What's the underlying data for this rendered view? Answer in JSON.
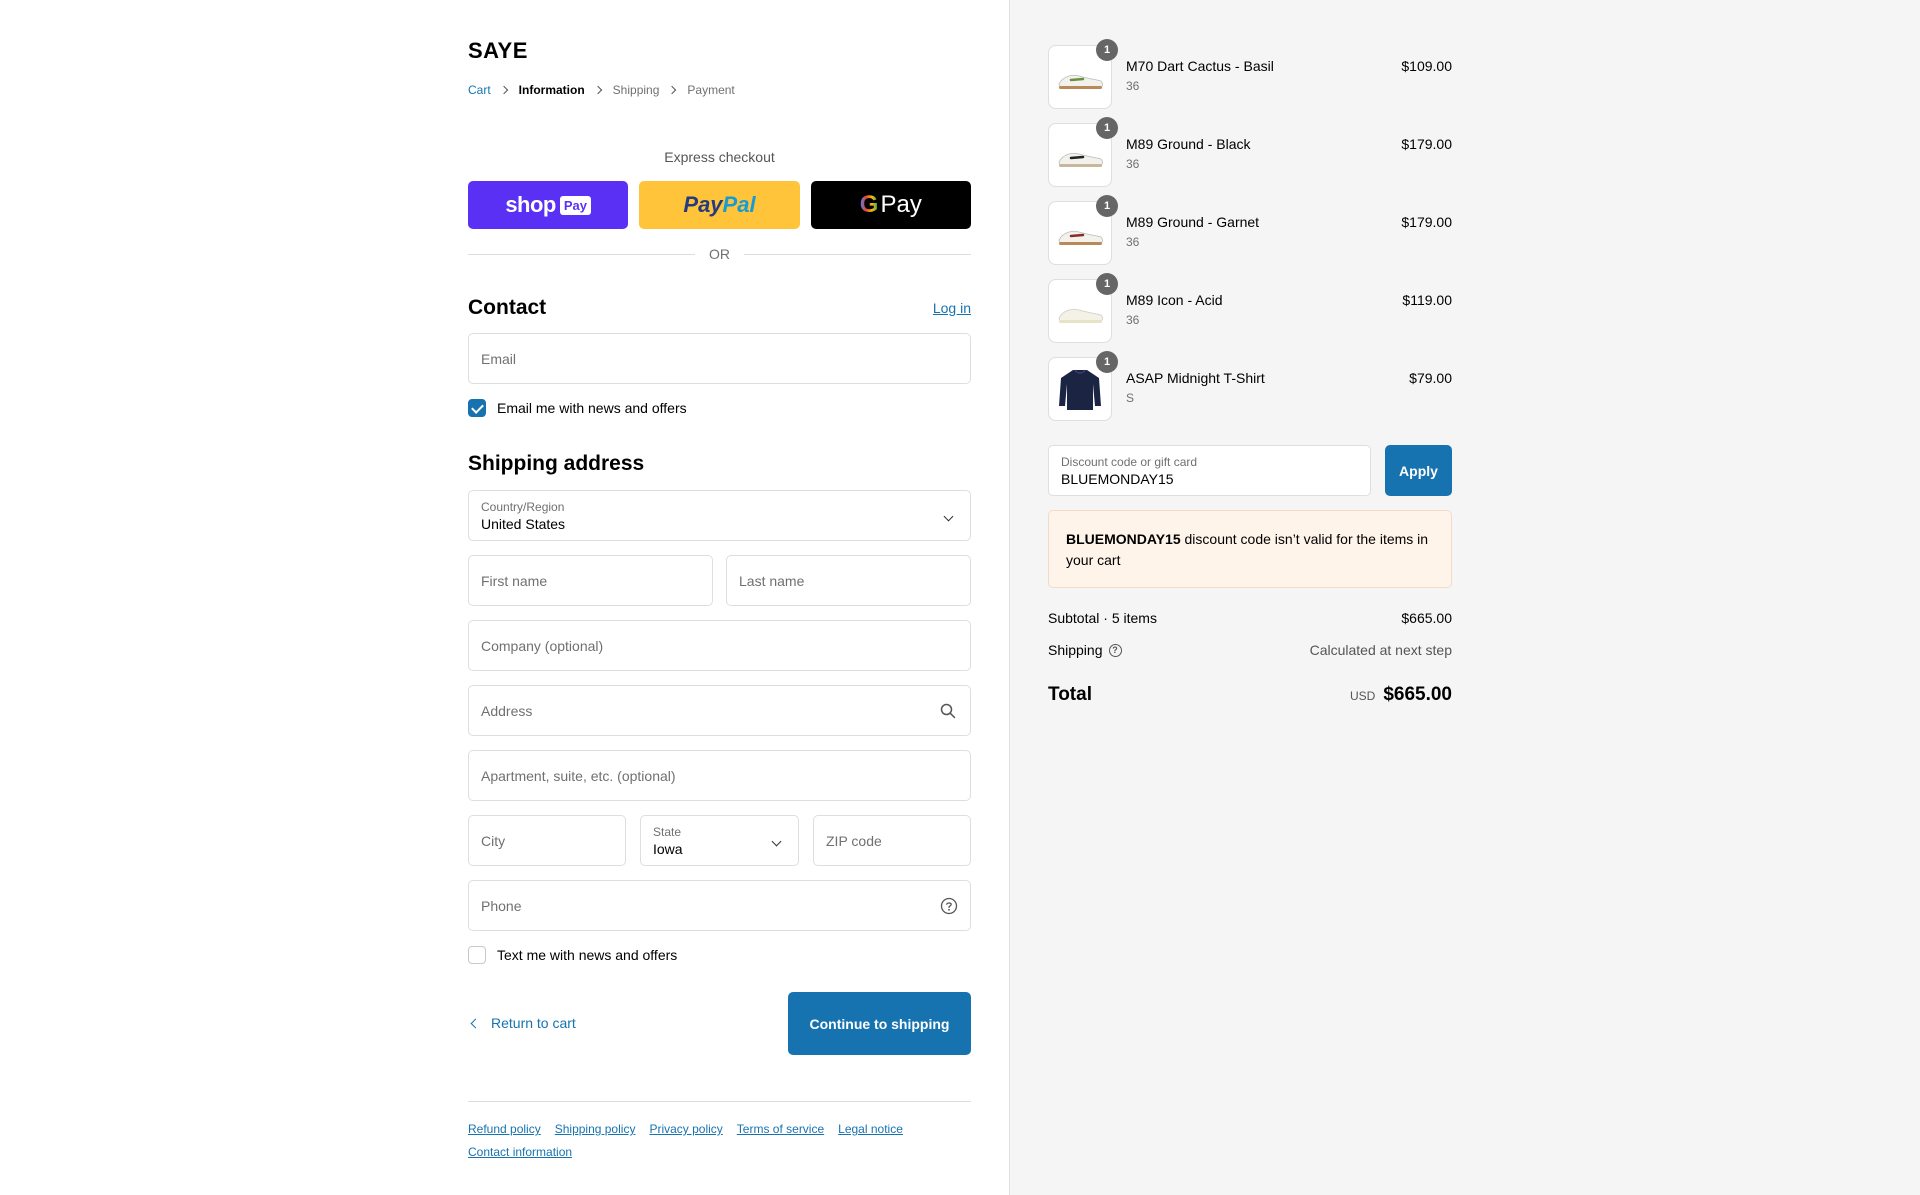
{
  "store": {
    "name": "SAYE"
  },
  "breadcrumb": [
    "Cart",
    "Information",
    "Shipping",
    "Payment"
  ],
  "express": {
    "title": "Express checkout",
    "shop_pay": {
      "shop": "shop",
      "pay": "Pay"
    },
    "paypal": {
      "part1": "Pay",
      "part2": "Pal"
    },
    "gpay": {
      "g": "G",
      "pay": "Pay"
    },
    "or": "OR"
  },
  "contact": {
    "title": "Contact",
    "login": "Log in",
    "email_placeholder": "Email",
    "email_optin": "Email me with news and offers",
    "email_optin_checked": true
  },
  "shipping": {
    "title": "Shipping address",
    "country_label": "Country/Region",
    "country_value": "United States",
    "first_name": "First name",
    "last_name": "Last name",
    "company": "Company (optional)",
    "address": "Address",
    "apartment": "Apartment, suite, etc. (optional)",
    "city": "City",
    "state_label": "State",
    "state_value": "Iowa",
    "zip": "ZIP code",
    "phone": "Phone",
    "text_optin": "Text me with news and offers",
    "text_optin_checked": false
  },
  "actions": {
    "return": "Return to cart",
    "continue": "Continue to shipping"
  },
  "footer": {
    "links": [
      "Refund policy",
      "Shipping policy",
      "Privacy policy",
      "Terms of service",
      "Legal notice",
      "Contact information"
    ]
  },
  "summary": {
    "items": [
      {
        "name": "M70 Dart Cactus - Basil",
        "variant": "36",
        "price": "$109.00",
        "qty": "1",
        "image": "sneaker-icon",
        "accent": "#6b8f3e"
      },
      {
        "name": "M89 Ground - Black",
        "variant": "36",
        "price": "$179.00",
        "qty": "1",
        "image": "sneaker-icon",
        "accent": "#222222"
      },
      {
        "name": "M89 Ground - Garnet",
        "variant": "36",
        "price": "$179.00",
        "qty": "1",
        "image": "sneaker-icon",
        "accent": "#8b2a2a"
      },
      {
        "name": "M89 Icon - Acid",
        "variant": "36",
        "price": "$119.00",
        "qty": "1",
        "image": "sneaker-icon",
        "accent": "#e6e3c6"
      },
      {
        "name": "ASAP Midnight T-Shirt",
        "variant": "S",
        "price": "$79.00",
        "qty": "1",
        "image": "sweater-icon",
        "accent": "#1c2444"
      }
    ],
    "discount_label": "Discount code or gift card",
    "discount_value": "BLUEMONDAY15",
    "apply": "Apply",
    "error_code": "BLUEMONDAY15",
    "error_text": " discount code isn’t valid for the items in your cart",
    "subtotal_label": "Subtotal · 5 items",
    "subtotal_value": "$665.00",
    "shipping_label": "Shipping",
    "shipping_value": "Calculated at next step",
    "total_label": "Total",
    "currency": "USD",
    "total_value": "$665.00"
  },
  "colors": {
    "accent": "#1773b0",
    "shop_pay": "#5a31f4",
    "paypal": "#ffc439",
    "error_bg": "#fff4ea"
  }
}
